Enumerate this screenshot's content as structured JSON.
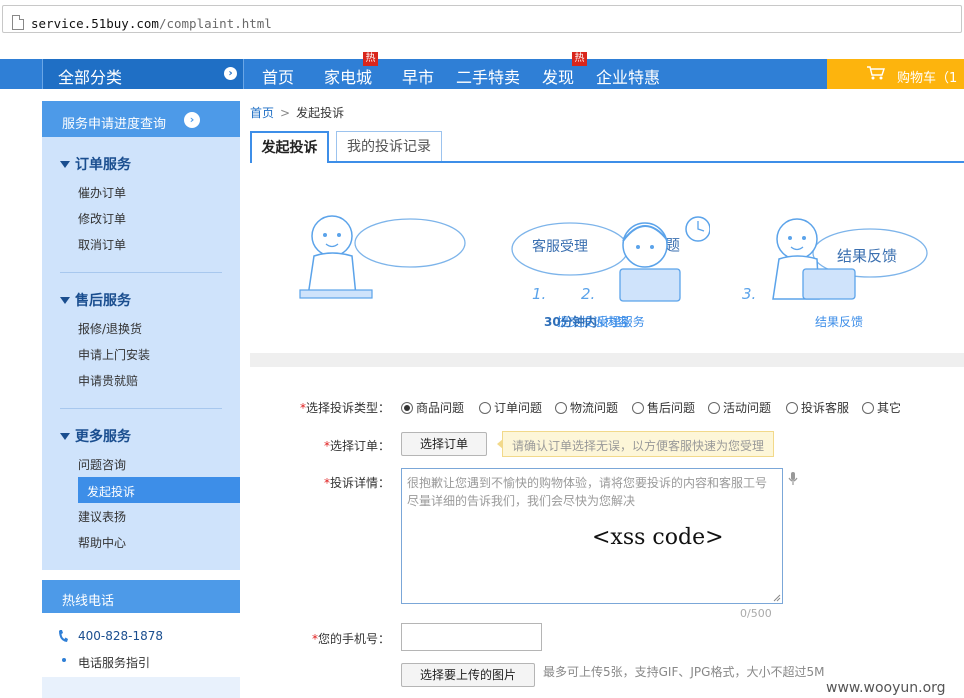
{
  "browser": {
    "url_domain": "service.51buy.com",
    "url_path": "/complaint.html"
  },
  "nav": {
    "all_categories": "全部分类",
    "items": [
      {
        "label": "首页",
        "hot": ""
      },
      {
        "label": "家电城",
        "hot": "热"
      },
      {
        "label": "早市",
        "hot": ""
      },
      {
        "label": "二手特卖",
        "hot": ""
      },
      {
        "label": "发现",
        "hot": "热"
      },
      {
        "label": "企业特惠",
        "hot": ""
      }
    ],
    "cart": "购物车（1"
  },
  "sidebar": {
    "header": "服务申请进度查询",
    "sections": [
      {
        "title": "订单服务",
        "items": [
          "催办订单",
          "修改订单",
          "取消订单"
        ]
      },
      {
        "title": "售后服务",
        "items": [
          "报修/退换货",
          "申请上门安装",
          "申请贵就赔"
        ]
      },
      {
        "title": "更多服务",
        "items": [
          "问题咨询",
          "发起投诉",
          "建议表扬",
          "帮助中心"
        ]
      }
    ],
    "active_item": "发起投诉",
    "hotline_title": "热线电话",
    "hotline_number": "400-828-1878",
    "hotline_guide": "电话服务指引"
  },
  "breadcrumb": {
    "home": "首页",
    "separator": ">",
    "current": "发起投诉"
  },
  "tabs": [
    {
      "label": "发起投诉",
      "active": true
    },
    {
      "label": "我的投诉记录",
      "active": false
    }
  ],
  "steps": [
    {
      "number": "1.",
      "bubble": "提交问题",
      "caption_strong": "",
      "caption": "提交投诉内容"
    },
    {
      "number": "2.",
      "bubble": "客服受理",
      "caption_strong": "30分钟内",
      "caption": "受理服务"
    },
    {
      "number": "3.",
      "bubble": "结果反馈",
      "caption_strong": "",
      "caption": "结果反馈"
    }
  ],
  "form": {
    "required_mark": "*",
    "type_label": "选择投诉类型：",
    "types": [
      "商品问题",
      "订单问题",
      "物流问题",
      "售后问题",
      "活动问题",
      "投诉客服",
      "其它"
    ],
    "selected_type": "商品问题",
    "order_label": "选择订单：",
    "order_button": "选择订单",
    "order_tip": "请确认订单选择无误，以方便客服快速为您受理",
    "detail_label": "投诉详情：",
    "detail_placeholder": "很抱歉让您遇到不愉快的购物体验，请将您要投诉的内容和客服工号尽量详细的告诉我们，我们会尽快为您解决",
    "detail_value": "<xss code>",
    "char_count": "0/500",
    "phone_label": "您的手机号：",
    "phone_value": "",
    "upload_button": "选择要上传的图片",
    "upload_hint": "最多可上传5张，支持GIF、JPG格式，大小不超过5M"
  },
  "watermark": "www.wooyun.org",
  "colors": {
    "nav_blue": "#2f7fd6",
    "cart_orange": "#fdb40d",
    "hot_red": "#d9261c",
    "sidebar_bg": "#cfe3fb",
    "accent": "#3d8ee8"
  }
}
